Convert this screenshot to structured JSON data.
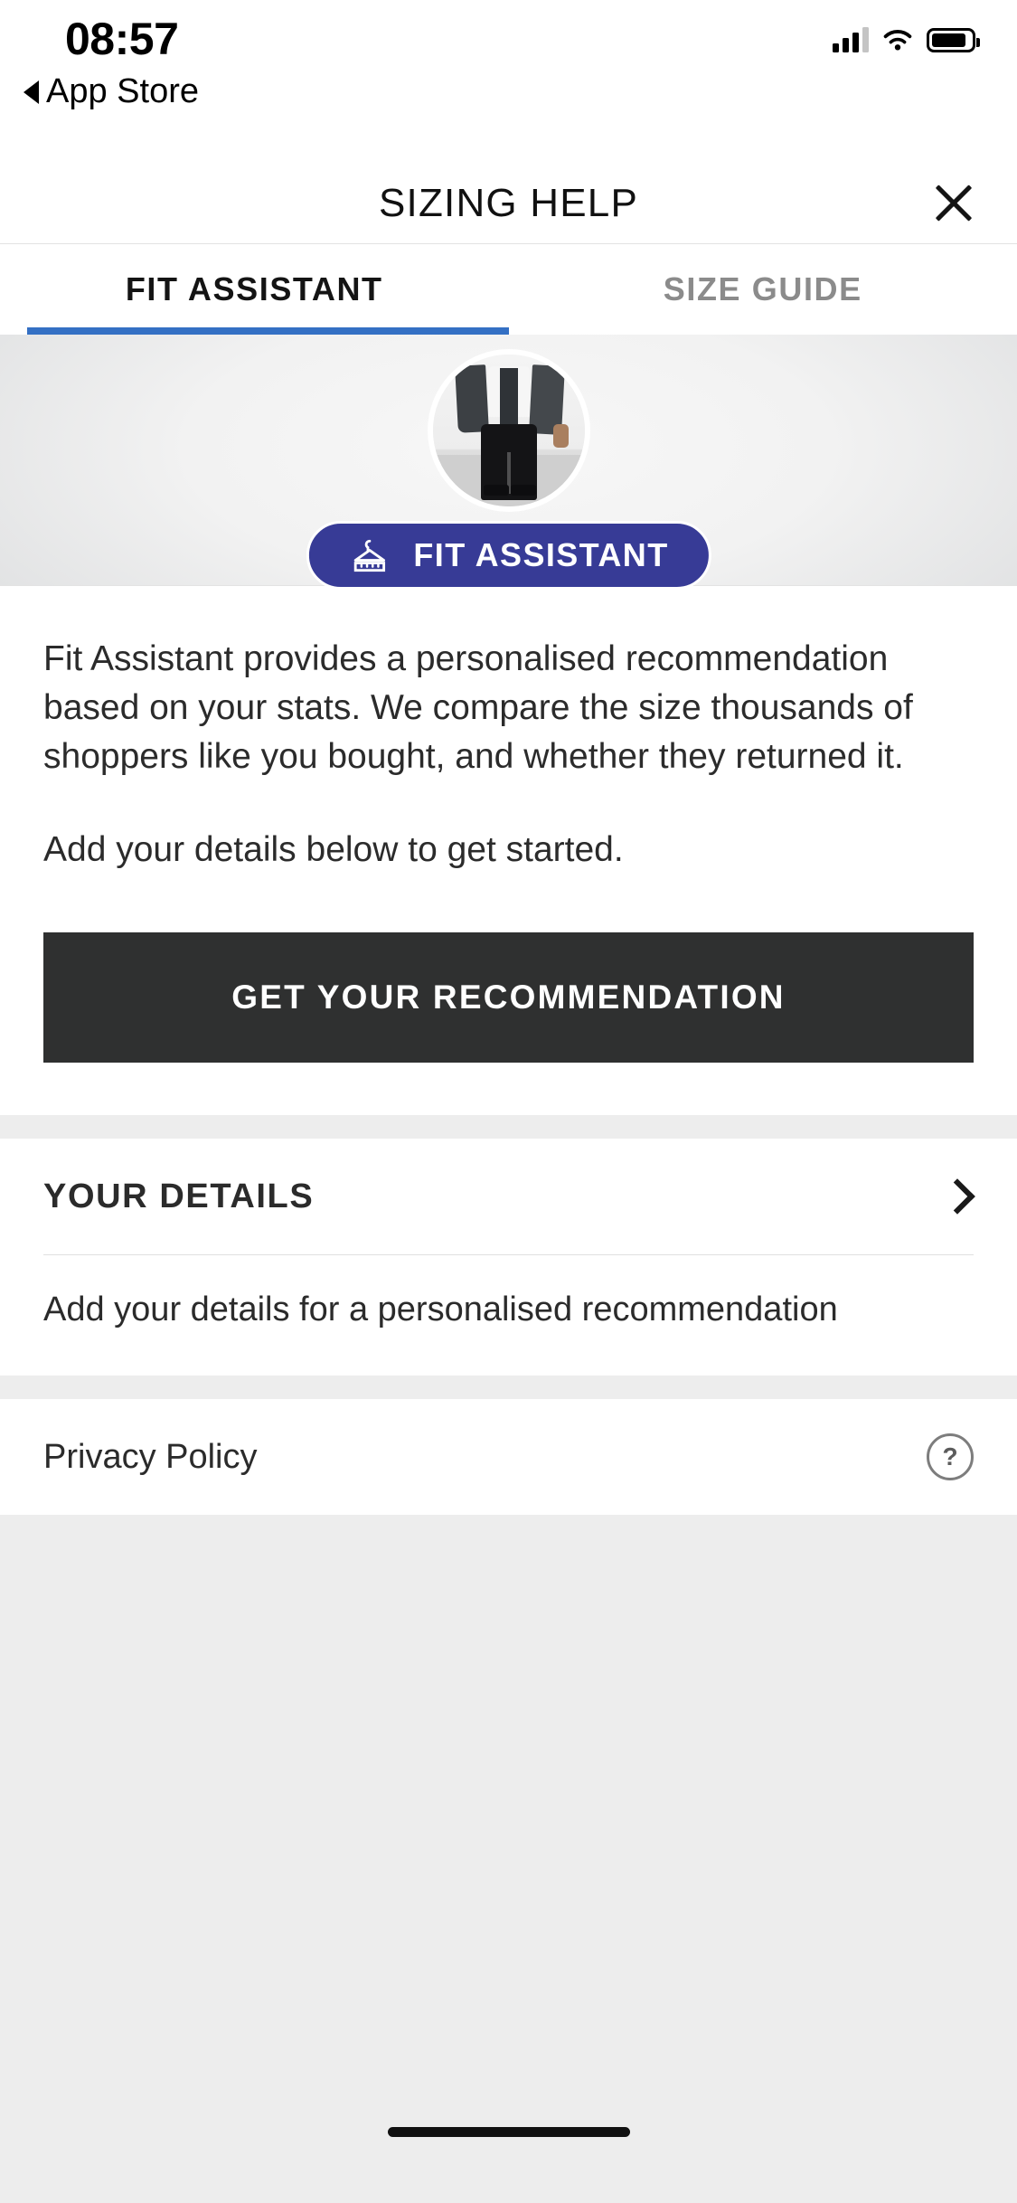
{
  "status_bar": {
    "time": "08:57",
    "back_label": "App Store",
    "signal_icon": "cellular-signal-icon",
    "wifi_icon": "wifi-icon",
    "battery_icon": "battery-icon"
  },
  "header": {
    "title": "SIZING HELP",
    "close_icon": "close-icon"
  },
  "tabs": [
    {
      "label": "FIT ASSISTANT",
      "active": true
    },
    {
      "label": "SIZE GUIDE",
      "active": false
    }
  ],
  "hero": {
    "photo_alt": "person-wearing-denim-jacket-and-black-jeans",
    "badge_label": "FIT ASSISTANT",
    "badge_icon": "clothes-hanger-ruler-icon"
  },
  "body": {
    "paragraph_1": "Fit Assistant provides a personalised recommendation based on your stats. We compare the size thousands of shoppers like you bought, and whether they returned it.",
    "paragraph_2": "Add your details below to get started."
  },
  "cta": {
    "label": "GET YOUR RECOMMENDATION"
  },
  "details_section": {
    "title": "YOUR DETAILS",
    "chevron_icon": "chevron-right-icon",
    "subtitle": "Add your details for a personalised recommendation"
  },
  "privacy_section": {
    "label": "Privacy Policy",
    "help_icon": "question-mark-icon"
  },
  "colors": {
    "tab_accent": "#3470c4",
    "badge_blue": "#373b96",
    "cta_dark": "#2f3030",
    "band_gray": "#ededed",
    "text_primary": "#2b2b2b",
    "text_muted": "#8b8b8b"
  }
}
